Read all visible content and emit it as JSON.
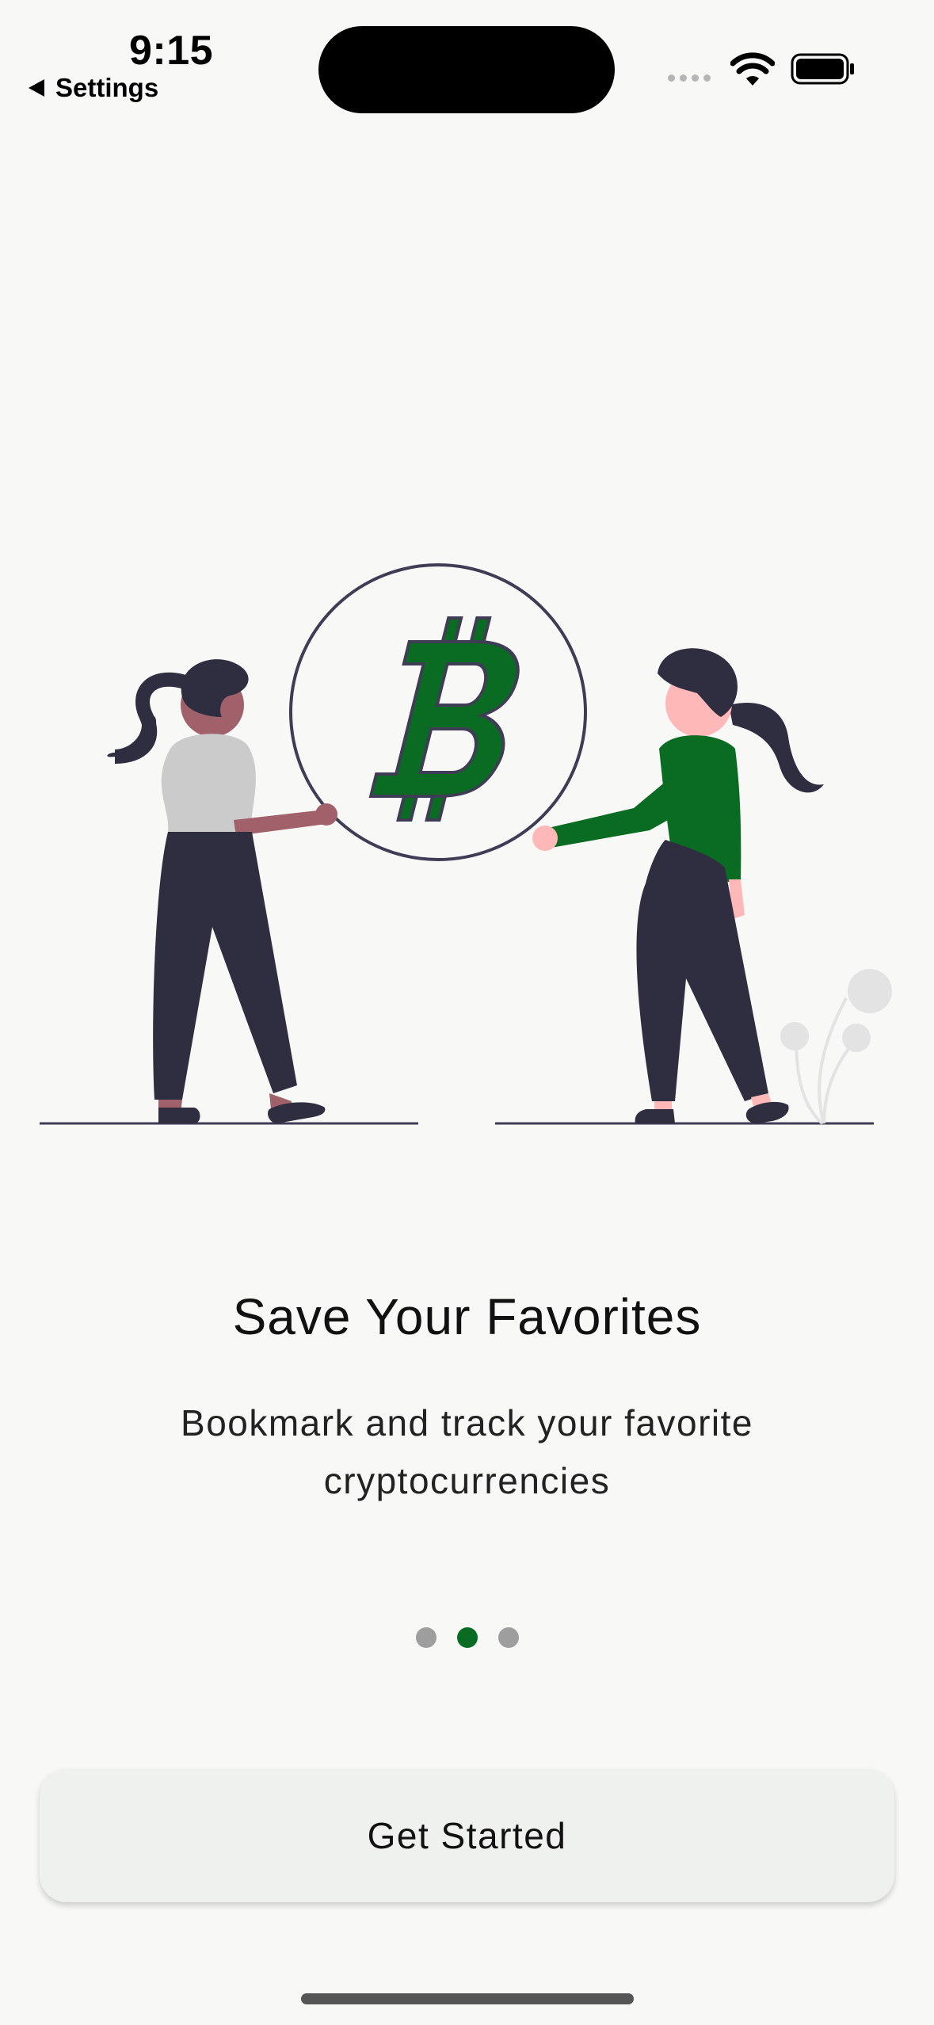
{
  "status_bar": {
    "time": "9:15",
    "back_label": "Settings"
  },
  "icons": {
    "back": "back-arrow-icon",
    "signal": "cellular-signal-icon",
    "wifi": "wifi-icon",
    "battery": "battery-icon",
    "illustration": "people-holding-bitcoin-illustration"
  },
  "onboarding": {
    "title": "Save Your Favorites",
    "subtitle": "Bookmark and track your favorite cryptocurrencies",
    "page_indicator": {
      "total": 3,
      "current": 2
    },
    "cta_label": "Get Started"
  },
  "colors": {
    "accent": "#0a6b22",
    "background": "#f8f9f7",
    "button_bg": "#eef1ed",
    "dot_inactive": "#9e9e9e"
  }
}
